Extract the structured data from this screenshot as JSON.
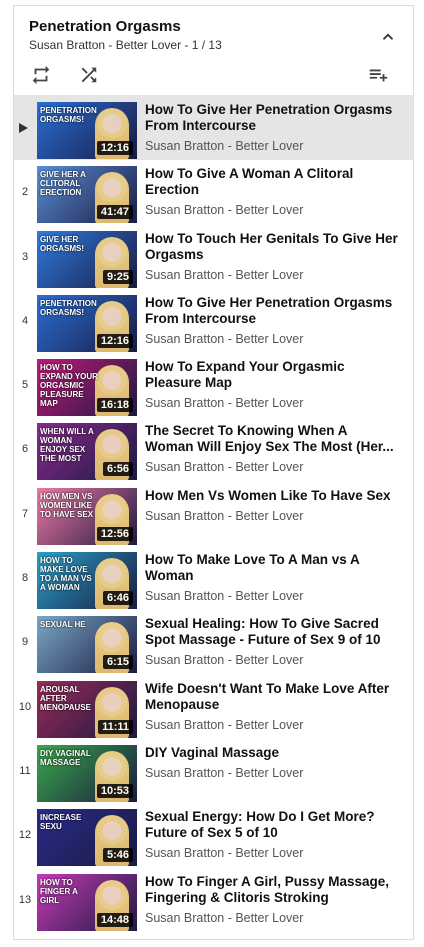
{
  "playlist": {
    "title": "Penetration Orgasms",
    "subtitle": "Susan Bratton - Better Lover - 1 / 13"
  },
  "icons": {
    "collapse": "chevron-up-icon",
    "loop": "loop-icon",
    "shuffle": "shuffle-icon",
    "save": "playlist-add-icon"
  },
  "items": [
    {
      "index": "",
      "title": "How To Give Her Penetration Orgasms From Intercourse",
      "channel": "Susan Bratton - Better Lover",
      "duration": "12:16",
      "thumb_text": "Penetration Orgasms!",
      "thumb_color": "#2a6fd6",
      "active": true
    },
    {
      "index": "2",
      "title": "How To Give A Woman A Clitoral Erection",
      "channel": "Susan Bratton - Better Lover",
      "duration": "41:47",
      "thumb_text": "Give Her A Clitoral Erection",
      "thumb_color": "#5a8fd8",
      "active": false
    },
    {
      "index": "3",
      "title": "How To Touch Her Genitals To Give Her Orgasms",
      "channel": "Susan Bratton - Better Lover",
      "duration": "9:25",
      "thumb_text": "Give Her Orgasms!",
      "thumb_color": "#2f7be0",
      "active": false
    },
    {
      "index": "4",
      "title": "How To Give Her Penetration Orgasms From Intercourse",
      "channel": "Susan Bratton - Better Lover",
      "duration": "12:16",
      "thumb_text": "Penetration Orgasms!",
      "thumb_color": "#2a6fd6",
      "active": false
    },
    {
      "index": "5",
      "title": "How To Expand Your Orgasmic Pleasure Map",
      "channel": "Susan Bratton - Better Lover",
      "duration": "16:18",
      "thumb_text": "How To Expand Your Orgasmic Pleasure Map",
      "thumb_color": "#c2187a",
      "active": false
    },
    {
      "index": "6",
      "title": "The Secret To Knowing When A Woman Will Enjoy Sex The Most (Her...",
      "channel": "Susan Bratton - Better Lover",
      "duration": "6:56",
      "thumb_text": "When Will A Woman Enjoy Sex The Most",
      "thumb_color": "#8a2a8e",
      "active": false
    },
    {
      "index": "7",
      "title": "How Men Vs Women Like To Have Sex",
      "channel": "Susan Bratton - Better Lover",
      "duration": "12:56",
      "thumb_text": "How Men Vs Women Like To Have Sex",
      "thumb_color": "#f07aa5",
      "active": false
    },
    {
      "index": "8",
      "title": "How To Make Love To A Man vs A Woman",
      "channel": "Susan Bratton - Better Lover",
      "duration": "6:46",
      "thumb_text": "How To Make Love To A Man Vs A Woman",
      "thumb_color": "#2aa0c8",
      "active": false
    },
    {
      "index": "9",
      "title": "Sexual Healing: How To Give Sacred Spot Massage - Future of Sex 9 of 10",
      "channel": "Susan Bratton - Better Lover",
      "duration": "6:15",
      "thumb_text": "Sexual He",
      "thumb_color": "#7aa8c8",
      "active": false
    },
    {
      "index": "10",
      "title": "Wife Doesn't Want To Make Love After Menopause",
      "channel": "Susan Bratton - Better Lover",
      "duration": "11:11",
      "thumb_text": "Arousal After Menopause",
      "thumb_color": "#9a2a5a",
      "active": false
    },
    {
      "index": "11",
      "title": "DIY Vaginal Massage",
      "channel": "Susan Bratton - Better Lover",
      "duration": "10:53",
      "thumb_text": "DIY Vaginal Massage",
      "thumb_color": "#3aa84a",
      "active": false
    },
    {
      "index": "12",
      "title": "Sexual Energy: How Do I Get More? Future of Sex 5 of 10",
      "channel": "Susan Bratton - Better Lover",
      "duration": "5:46",
      "thumb_text": "Increase Sexu",
      "thumb_color": "#2a2a8a",
      "active": false
    },
    {
      "index": "13",
      "title": "How To Finger A Girl, Pussy Massage, Fingering & Clitoris Stroking",
      "channel": "Susan Bratton - Better Lover",
      "duration": "14:48",
      "thumb_text": "How To Finger A Girl",
      "thumb_color": "#c83ab8",
      "active": false
    }
  ]
}
